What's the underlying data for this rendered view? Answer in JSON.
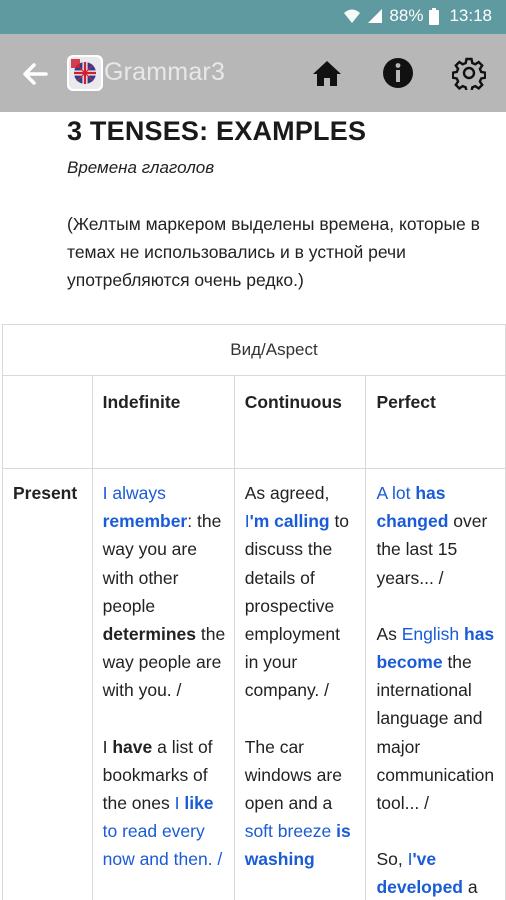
{
  "status": {
    "battery": "88%",
    "time": "13:18"
  },
  "appbar": {
    "title": "Grammar3",
    "icons": [
      "back-arrow-icon",
      "home-icon",
      "info-icon",
      "gear-icon"
    ]
  },
  "page": {
    "title": "3 TENSES: EXAMPLES",
    "subtitle": "Времена глаголов",
    "note": "(Желтым маркером выделены времена, которые в темах не использовались и в устной речи употребляются очень редко.)"
  },
  "table": {
    "aspect_header": "Вид/Aspect",
    "columns": [
      "Indefinite",
      "Continuous",
      "Perfect"
    ],
    "row_label": "Present",
    "indefinite": {
      "p1": [
        "I always ",
        "remember",
        ": the way you are with other people ",
        "determines",
        " the way people are with you. /"
      ],
      "p2": [
        "I ",
        "have",
        " a list of bookmarks of the ones ",
        "I ",
        "like",
        " to read every now and then. /"
      ]
    },
    "continuous": {
      "p1": [
        "As agreed, ",
        "I",
        "'m calling",
        " to discuss the details of prospective employment in your company. /"
      ],
      "p2": [
        "The car windows are open and a ",
        "soft breeze ",
        "is",
        " washing"
      ]
    },
    "perfect": {
      "p1": [
        "A lot ",
        "has changed",
        " over the last 15 years... /"
      ],
      "p2": [
        "As ",
        "English ",
        "has become",
        " the international language and major communication tool... /"
      ],
      "p3": [
        "So, ",
        "I",
        "'ve developed",
        " a habit of"
      ]
    }
  }
}
